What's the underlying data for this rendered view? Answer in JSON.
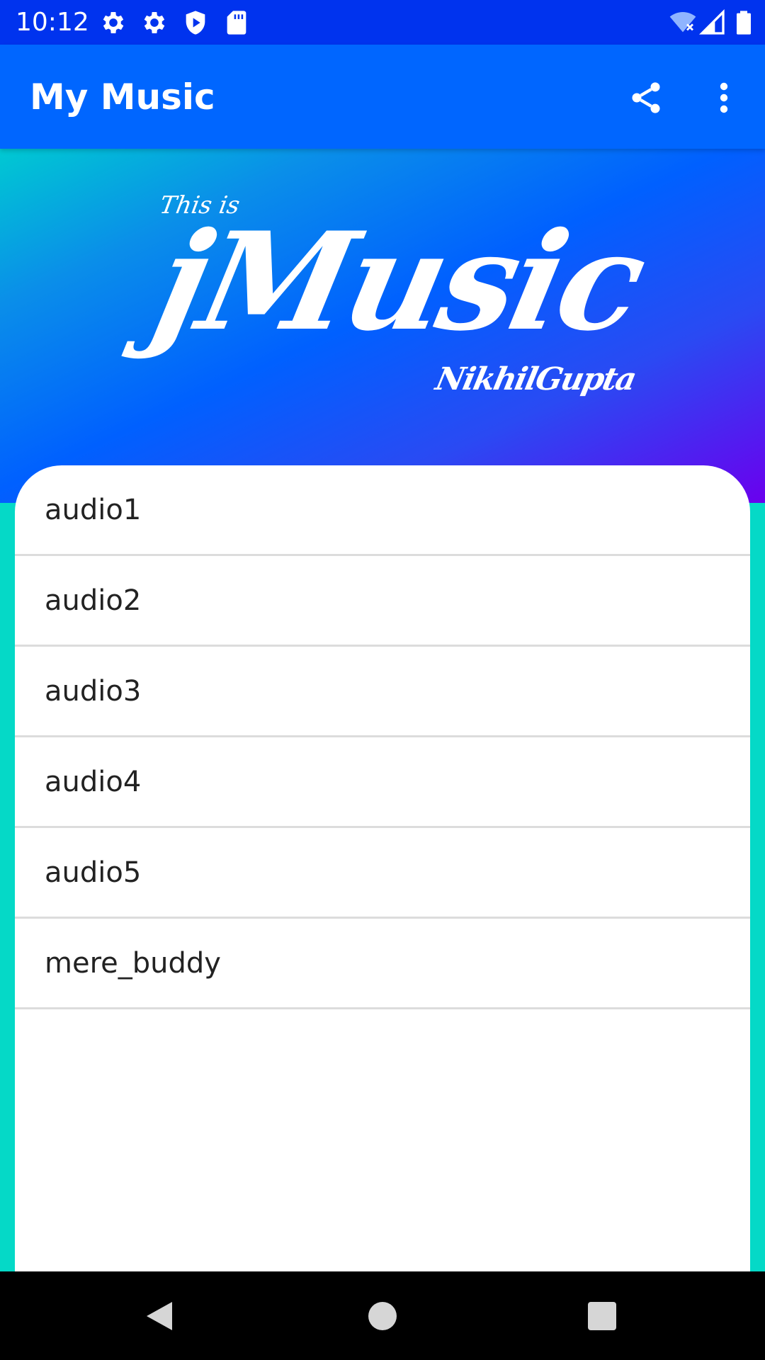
{
  "status_bar": {
    "time": "10:12",
    "icons": [
      "settings-icon",
      "settings-icon",
      "play-protect-icon",
      "sd-card-icon",
      "wifi-off-icon",
      "signal-icon",
      "battery-icon"
    ]
  },
  "app_bar": {
    "title": "My Music",
    "actions": [
      "share-icon",
      "more-vert-icon"
    ]
  },
  "banner": {
    "pre_title": "This is",
    "logo": "jMusic",
    "author": "NikhilGupta"
  },
  "playlist": {
    "items": [
      {
        "label": "audio1"
      },
      {
        "label": "audio2"
      },
      {
        "label": "audio3"
      },
      {
        "label": "audio4"
      },
      {
        "label": "audio5"
      },
      {
        "label": "mere_buddy"
      }
    ]
  },
  "navigation": {
    "buttons": [
      "back-icon",
      "home-icon",
      "recents-icon"
    ]
  },
  "colors": {
    "status_bar": "#0033ee",
    "app_bar": "#0066ff",
    "background_teal": "#05d9c7",
    "banner_gradient": [
      "#00c9d2",
      "#0060ff",
      "#6a00ee"
    ]
  }
}
